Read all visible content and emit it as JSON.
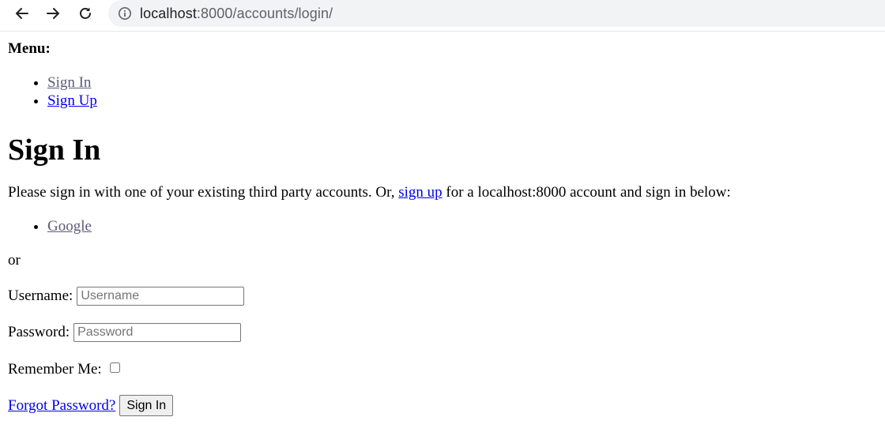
{
  "browser": {
    "url_host": "localhost",
    "url_rest": ":8000/accounts/login/"
  },
  "menu": {
    "label": "Menu:",
    "items": [
      {
        "label": "Sign In"
      },
      {
        "label": "Sign Up"
      }
    ]
  },
  "page": {
    "title": "Sign In",
    "intro_before": "Please sign in with one of your existing third party accounts. Or, ",
    "intro_link": "sign up",
    "intro_after": " for a localhost:8000 account and sign in below:",
    "providers": [
      {
        "label": "Google"
      }
    ],
    "or_text": "or"
  },
  "form": {
    "username_label": "Username:",
    "username_placeholder": "Username",
    "password_label": "Password:",
    "password_placeholder": "Password",
    "remember_label": "Remember Me:",
    "forgot_link": "Forgot Password?",
    "submit_label": "Sign In"
  }
}
